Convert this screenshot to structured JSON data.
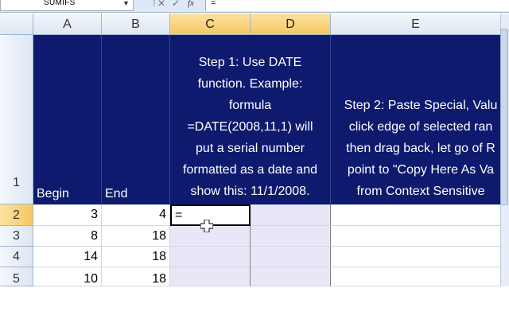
{
  "formula_bar": {
    "name_box": "SUMIFS",
    "cancel_symbol": "✕",
    "enter_symbol": "✓",
    "fx_label": "fx",
    "formula": "="
  },
  "columns": [
    "A",
    "B",
    "C",
    "D",
    "E"
  ],
  "rows": [
    "1",
    "2",
    "3",
    "4",
    "5"
  ],
  "header_row": {
    "a": "Begin",
    "b": "End",
    "cd_lines": [
      "Step 1: Use DATE",
      "function. Example:",
      "formula",
      "=DATE(2008,11,1) will",
      "put a serial number",
      "formatted as a date and",
      "show this: 11/1/2008."
    ],
    "e_lines": [
      "Step 2: Paste Special, Valu",
      "click edge of selected ran",
      "then drag back, let go of R",
      "point to \"Copy Here As Va",
      "from Context Sensitive"
    ]
  },
  "data_rows": [
    {
      "begin": "3",
      "end": "4",
      "c": "="
    },
    {
      "begin": "8",
      "end": "18",
      "c": ""
    },
    {
      "begin": "14",
      "end": "18",
      "c": ""
    },
    {
      "begin": "10",
      "end": "18",
      "c": ""
    }
  ],
  "colors": {
    "header_fill": "#0e1a6e",
    "selection_fill": "#e9e6f8",
    "selected_header": "#f7c760"
  },
  "icons": {
    "dropdown": "chevron-down-icon",
    "cancel": "cancel-icon",
    "enter": "enter-icon",
    "cursor": "cell-cursor-icon"
  }
}
